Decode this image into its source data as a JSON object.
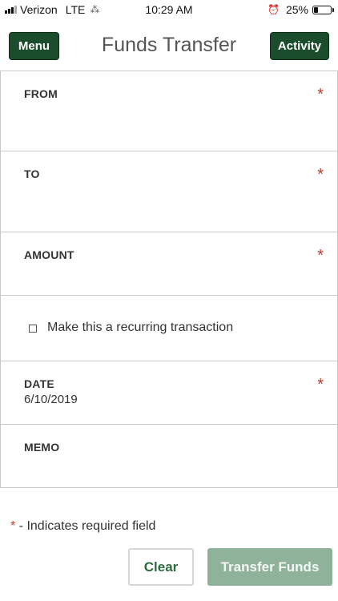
{
  "status_bar": {
    "carrier": "Verizon",
    "network": "LTE",
    "time": "10:29 AM",
    "battery_percent": "25%",
    "battery_level": 0.25,
    "icons": [
      "signal-icon",
      "loading-icon",
      "alarm-icon",
      "battery-icon"
    ]
  },
  "header": {
    "menu_label": "Menu",
    "title": "Funds Transfer",
    "activity_label": "Activity"
  },
  "form": {
    "from": {
      "label": "FROM",
      "value": "",
      "required_mark": "*"
    },
    "to": {
      "label": "TO",
      "value": "",
      "required_mark": "*"
    },
    "amount": {
      "label": "AMOUNT",
      "value": "",
      "required_mark": "*"
    },
    "recurring": {
      "label": "Make this a recurring transaction",
      "checked": false
    },
    "date": {
      "label": "DATE",
      "value": "6/10/2019",
      "required_mark": "*"
    },
    "memo": {
      "label": "MEMO",
      "value": ""
    }
  },
  "footnote": {
    "star": "*",
    "text": " - Indicates required field"
  },
  "actions": {
    "clear_label": "Clear",
    "transfer_label": "Transfer Funds"
  },
  "colors": {
    "primary_green": "#1b4d2c",
    "disabled_green": "#8fb29a",
    "required_red": "#c0392b"
  }
}
